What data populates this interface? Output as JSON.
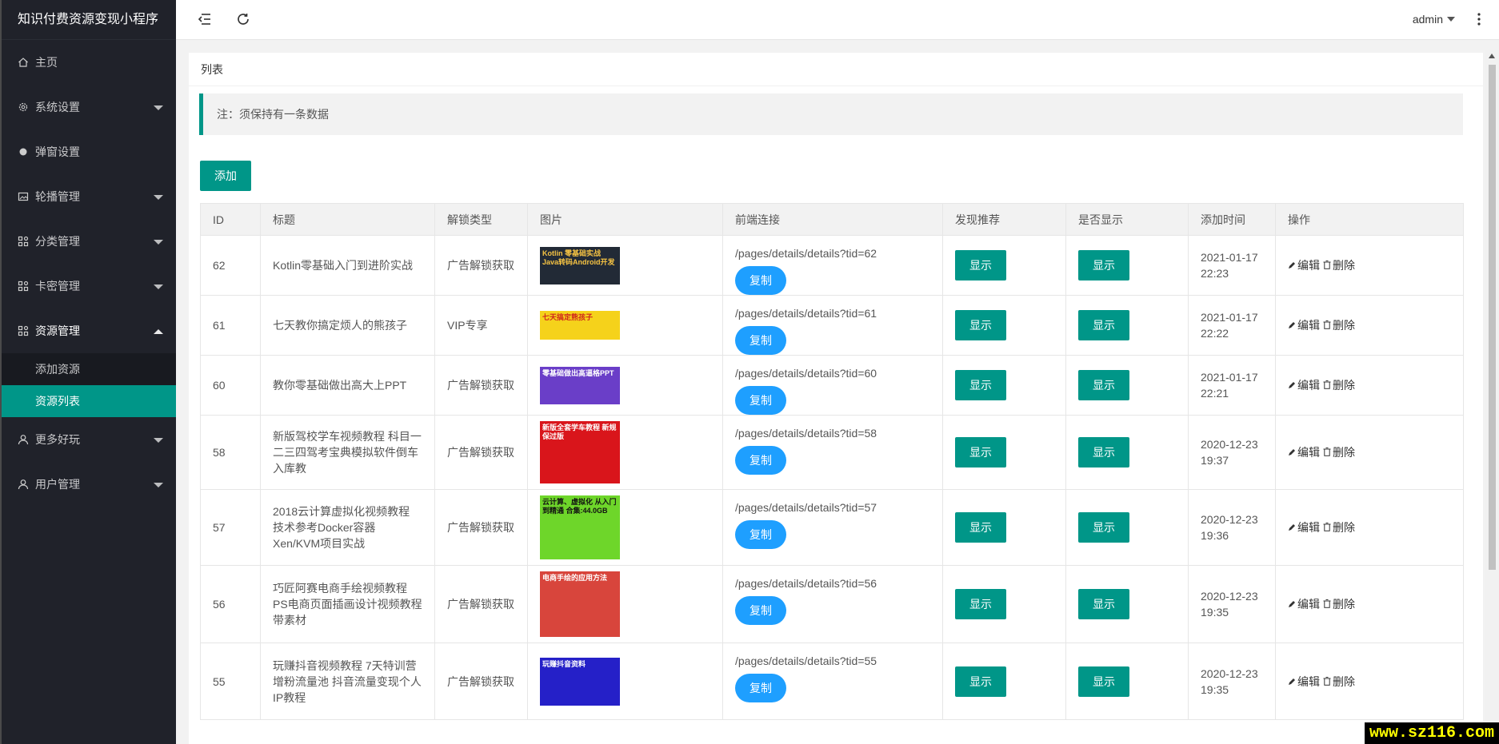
{
  "app": {
    "title": "知识付费资源变现小程序"
  },
  "sidebar": {
    "items": [
      {
        "label": "主页",
        "icon": "home-icon",
        "caret": ""
      },
      {
        "label": "系统设置",
        "icon": "gear-icon",
        "caret": "down"
      },
      {
        "label": "弹窗设置",
        "icon": "dot-icon",
        "caret": ""
      },
      {
        "label": "轮播管理",
        "icon": "image-icon",
        "caret": "down"
      },
      {
        "label": "分类管理",
        "icon": "apps-icon",
        "caret": "down"
      },
      {
        "label": "卡密管理",
        "icon": "apps-icon",
        "caret": "down"
      },
      {
        "label": "资源管理",
        "icon": "apps-icon",
        "caret": "up"
      }
    ],
    "sub_items": [
      {
        "label": "添加资源",
        "active": false
      },
      {
        "label": "资源列表",
        "active": true
      }
    ],
    "items_after": [
      {
        "label": "更多好玩",
        "icon": "user-icon",
        "caret": "down"
      },
      {
        "label": "用户管理",
        "icon": "user-icon",
        "caret": "down"
      }
    ]
  },
  "header": {
    "user": "admin"
  },
  "card": {
    "title": "列表",
    "note": "注：须保持有一条数据",
    "add_label": "添加"
  },
  "table": {
    "headers": [
      "ID",
      "标题",
      "解锁类型",
      "图片",
      "前端连接",
      "发现推荐",
      "是否显示",
      "添加时间",
      "操作"
    ],
    "copy_label": "复制",
    "show_label": "显示",
    "edit_label": "编辑",
    "delete_label": "删除",
    "rows": [
      {
        "id": "62",
        "title": "Kotlin零基础入门到进阶实战",
        "type": "广告解锁获取",
        "link": "/pages/details/details?tid=62",
        "date": "2021-01-17",
        "time": "22:23",
        "img_text": "Kotlin 零基础实战 Java转码Android开发",
        "img_bg": "#222a36",
        "img_fg": "#f6c343",
        "img_h": 47,
        "height": 64
      },
      {
        "id": "61",
        "title": "七天教你搞定烦人的熊孩子",
        "type": "VIP专享",
        "link": "/pages/details/details?tid=61",
        "date": "2021-01-17",
        "time": "22:22",
        "img_text": "七天搞定熊孩子",
        "img_bg": "#f5d21b",
        "img_fg": "#d0261c",
        "img_h": 36,
        "height": 64
      },
      {
        "id": "60",
        "title": "教你零基础做出高大上PPT",
        "type": "广告解锁获取",
        "link": "/pages/details/details?tid=60",
        "date": "2021-01-17",
        "time": "22:21",
        "img_text": "零基础做出高逼格PPT",
        "img_bg": "#6a3ec8",
        "img_fg": "#ffffff",
        "img_h": 47,
        "height": 64
      },
      {
        "id": "58",
        "title": "新版驾校学车视频教程 科目一二三四驾考宝典模拟软件倒车入库教",
        "type": "广告解锁获取",
        "link": "/pages/details/details?tid=58",
        "date": "2020-12-23",
        "time": "19:37",
        "img_text": "新版全套学车教程 新规保过版",
        "img_bg": "#d9151b",
        "img_fg": "#ffffff",
        "img_h": 78,
        "height": 93
      },
      {
        "id": "57",
        "title": "2018云计算虚拟化视频教程 技术参考Docker容器Xen/KVM项目实战",
        "type": "广告解锁获取",
        "link": "/pages/details/details?tid=57",
        "date": "2020-12-23",
        "time": "19:36",
        "img_text": "云计算、虚拟化 从入门到精通 合集:44.0GB",
        "img_bg": "#6ed62a",
        "img_fg": "#111111",
        "img_h": 80,
        "height": 95
      },
      {
        "id": "56",
        "title": "巧匠阿赛电商手绘视频教程 PS电商页面插画设计视频教程带素材",
        "type": "广告解锁获取",
        "link": "/pages/details/details?tid=56",
        "date": "2020-12-23",
        "time": "19:35",
        "img_text": "电商手绘的应用方法",
        "img_bg": "#d8453c",
        "img_fg": "#ffffff",
        "img_h": 82,
        "height": 97
      },
      {
        "id": "55",
        "title": "玩赚抖音视频教程 7天特训营增粉流量池 抖音流量变现个人IP教程",
        "type": "广告解锁获取",
        "link": "/pages/details/details?tid=55",
        "date": "2020-12-23",
        "time": "19:35",
        "img_text": "玩赚抖音资料",
        "img_bg": "#2520c8",
        "img_fg": "#ffffff",
        "img_h": 60,
        "height": 96
      }
    ]
  },
  "watermark": "www.sz116.com"
}
